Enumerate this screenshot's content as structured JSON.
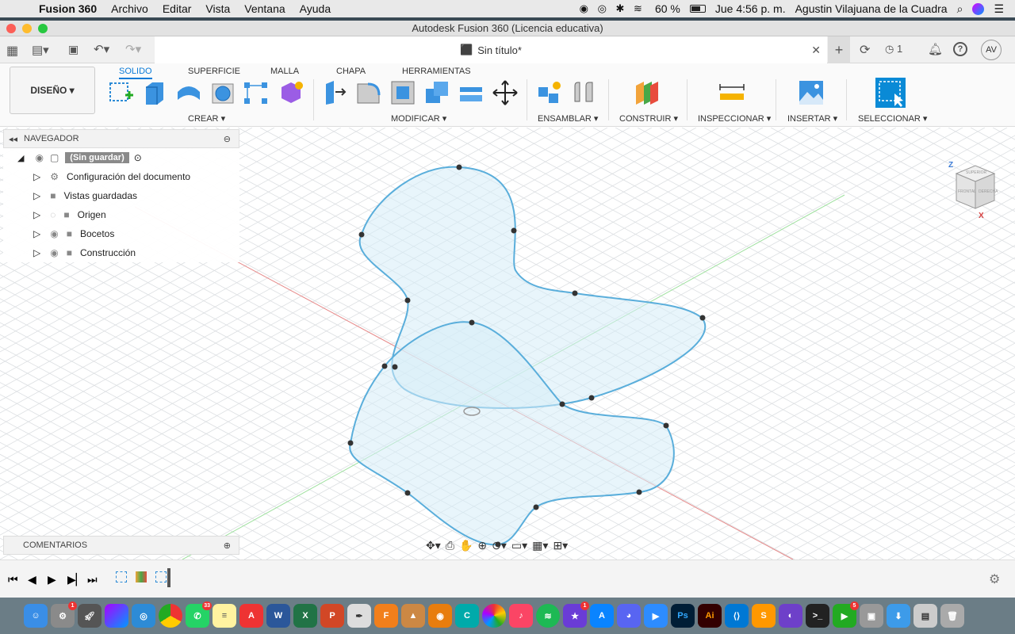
{
  "menubar": {
    "app_name": "Fusion 360",
    "items": [
      "Archivo",
      "Editar",
      "Vista",
      "Ventana",
      "Ayuda"
    ],
    "battery": "60 %",
    "clock": "Jue 4:56 p. m.",
    "user": "Agustin Vilajuana de la Cuadra"
  },
  "window": {
    "title": "Autodesk Fusion 360 (Licencia educativa)",
    "tab_title": "Sin título*",
    "jobs_count": "1",
    "user_initials": "AV"
  },
  "toolbar": {
    "workspace": "DISEÑO",
    "tabs": [
      "SOLIDO",
      "SUPERFICIE",
      "MALLA",
      "CHAPA",
      "HERRAMIENTAS"
    ],
    "groups": [
      "CREAR",
      "MODIFICAR",
      "ENSAMBLAR",
      "CONSTRUIR",
      "INSPECCIONAR",
      "INSERTAR",
      "SELECCIONAR"
    ]
  },
  "navigator": {
    "header": "NAVEGADOR",
    "root": "(Sin guardar)",
    "items": [
      "Configuración del documento",
      "Vistas guardadas",
      "Origen",
      "Bocetos",
      "Construcción"
    ]
  },
  "comments": {
    "header": "COMENTARIOS"
  },
  "viewcube": {
    "axis_z": "Z",
    "axis_x": "X",
    "face_top": "SUPERIOR",
    "face_front": "FRONTAL",
    "face_right": "DERECHA"
  },
  "colors": {
    "accent": "#0a7ad6",
    "sketch_stroke": "#5aaedb",
    "sketch_fill": "#d6ecf8"
  },
  "dock": {
    "badges": [
      "1",
      "33",
      "1",
      "5"
    ]
  }
}
